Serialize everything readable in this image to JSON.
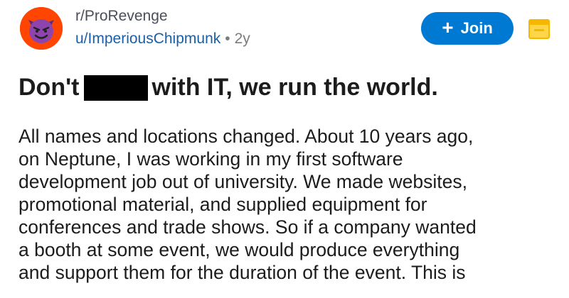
{
  "post": {
    "subreddit": "r/ProRevenge",
    "username": "u/ImperiousChipmunk",
    "separator": "•",
    "age": "2y",
    "title_start": "Don't",
    "title_end": "with IT, we run the world.",
    "body_lines": [
      "All names and locations changed. About 10 years ago,",
      "on Neptune, I was working in my first software",
      "development job out of university. We made websites,",
      "promotional material, and supplied equipment for",
      "conferences and trade shows. So if a company wanted",
      "a booth at some event, we would produce everything",
      "and support them for the duration of the event. This is"
    ]
  },
  "join_button": {
    "icon": "+",
    "label": "Join"
  },
  "colors": {
    "avatar": "#ff4500",
    "join": "#0079d3",
    "username": "#1a5fa8",
    "save": "#f5b700"
  },
  "icons": {
    "avatar": "devil-face-icon",
    "join": "plus-icon",
    "save": "save-bookmark-icon"
  }
}
